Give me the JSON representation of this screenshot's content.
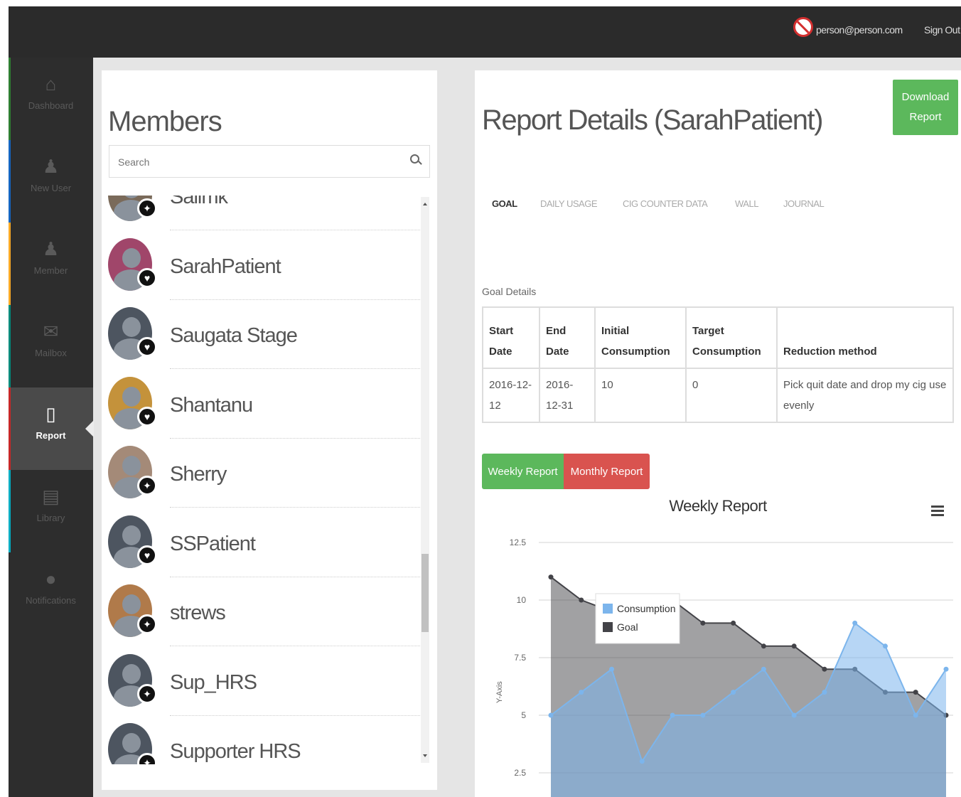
{
  "topbar": {
    "user_email": "person@person.com",
    "signout_label": "Sign Out"
  },
  "sidebar": {
    "items": [
      {
        "label": "Dashboard",
        "icon": "home-icon",
        "stripe": "#2e7d32"
      },
      {
        "label": "New User",
        "icon": "add-user-icon",
        "stripe": "#1565c0"
      },
      {
        "label": "Member",
        "icon": "group-icon",
        "stripe": "#f9a825"
      },
      {
        "label": "Mailbox",
        "icon": "mail-icon",
        "stripe": "#00897b"
      },
      {
        "label": "Report",
        "icon": "report-icon",
        "stripe": "#c62828",
        "active": true
      },
      {
        "label": "Library",
        "icon": "book-icon",
        "stripe": "#00acc1"
      },
      {
        "label": "Notifications",
        "icon": "chat-icon",
        "stripe": ""
      }
    ]
  },
  "members": {
    "title": "Members",
    "search_placeholder": "Search",
    "list": [
      {
        "name": "Salimk",
        "badge": "handshake-icon"
      },
      {
        "name": "SarahPatient",
        "badge": "heart-icon"
      },
      {
        "name": "Saugata Stage",
        "badge": "heart-icon"
      },
      {
        "name": "Shantanu",
        "badge": "heart-icon"
      },
      {
        "name": "Sherry",
        "badge": "handshake-icon"
      },
      {
        "name": "SSPatient",
        "badge": "heart-icon"
      },
      {
        "name": "strews",
        "badge": "handshake-icon"
      },
      {
        "name": "Sup_HRS",
        "badge": "handshake-icon"
      },
      {
        "name": "Supporter HRS",
        "badge": "handshake-icon"
      }
    ]
  },
  "report": {
    "title": "Report Details (SarahPatient)",
    "download_label": "Download Report",
    "tabs": [
      "GOAL",
      "DAILY USAGE",
      "CIG COUNTER DATA",
      "WALL",
      "JOURNAL"
    ],
    "active_tab": "GOAL",
    "goal_details_label": "Goal Details",
    "goal_table": {
      "headers": [
        "Start Date",
        "End Date",
        "Initial Consumption",
        "Target Consumption",
        "Reduction method"
      ],
      "row": [
        "2016-12-12",
        "2016-12-31",
        "10",
        "0",
        "Pick quit date and drop my cig use evenly"
      ]
    },
    "weekly_button": "Weekly Report",
    "monthly_button": "Monthly Report"
  },
  "chart_data": {
    "type": "area",
    "title": "Weekly Report",
    "ylabel": "Y-Axis",
    "yticks": [
      "12.5",
      "10",
      "7.5",
      "5",
      "2.5"
    ],
    "ylim": [
      0,
      12.5
    ],
    "grid": true,
    "legend_position": "top-left",
    "series": [
      {
        "name": "Consumption",
        "color": "#7cb5ec",
        "values": [
          5,
          6,
          7,
          3,
          5,
          5,
          6,
          7,
          5,
          6,
          9,
          8,
          5,
          7
        ]
      },
      {
        "name": "Goal",
        "color": "#434348",
        "values": [
          11,
          10,
          9.5,
          10,
          10,
          9,
          9,
          8,
          8,
          7,
          7,
          6,
          6,
          5
        ]
      }
    ]
  }
}
